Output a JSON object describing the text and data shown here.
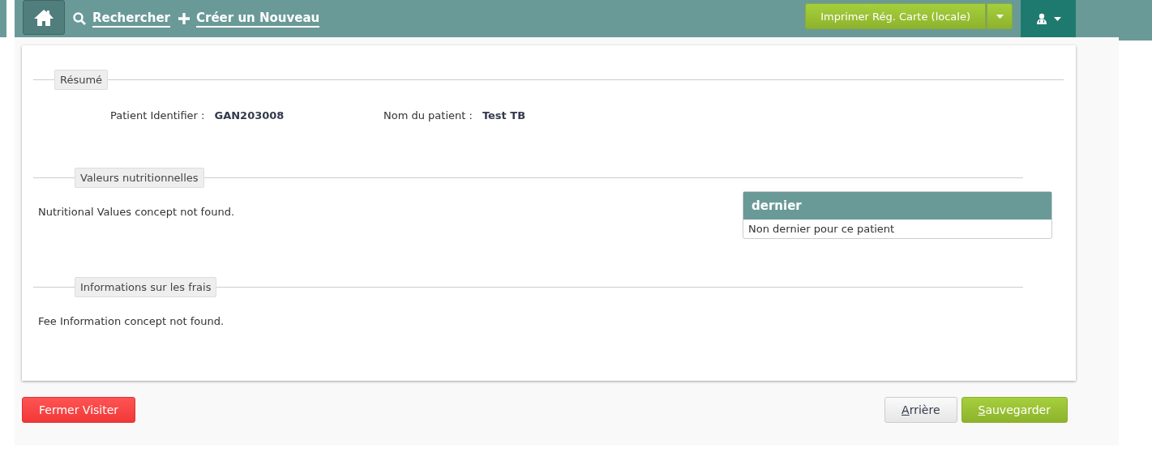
{
  "nav": {
    "links": [
      {
        "kind": "search",
        "label": "Rechercher"
      },
      {
        "kind": "create",
        "label": "Créer un Nouveau"
      }
    ],
    "print_button": "Imprimer Rég. Carte (locale)"
  },
  "summary": {
    "legend": "Résumé",
    "fields": [
      {
        "label": "Patient Identifier :",
        "value": "GAN203008"
      },
      {
        "label": "Nom du patient :",
        "value": "Test TB"
      }
    ]
  },
  "nutrition": {
    "legend": "Valeurs nutritionnelles",
    "message": "Nutritional Values concept not found.",
    "panel": {
      "title": "dernier",
      "body": "Non dernier pour ce patient"
    }
  },
  "fees": {
    "legend": "Informations sur les frais",
    "message": "Fee Information concept not found."
  },
  "actions": [
    {
      "kind": "danger",
      "label": "Fermer Visiter",
      "mnemonic": false
    },
    {
      "kind": "default",
      "label": "Arrière",
      "mnemonic": true
    },
    {
      "kind": "primary",
      "label": "Sauvegarder",
      "mnemonic": true
    }
  ]
}
